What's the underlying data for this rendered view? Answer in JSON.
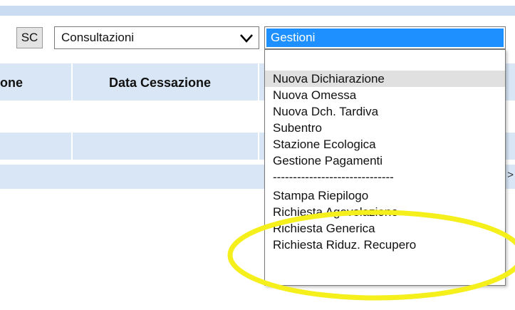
{
  "toolbar": {
    "sc_label": "SC",
    "consultazioni_value": "Consultazioni",
    "gestioni_value": "Gestioni"
  },
  "grid": {
    "columns": [
      "one",
      "Data Cessazione"
    ]
  },
  "gestioni_options": [
    "",
    "Nuova Dichiarazione",
    "Nuova Omessa",
    "Nuova Dch. Tardiva",
    "Subentro",
    "Stazione Ecologica",
    "Gestione Pagamenti",
    "------------------------------",
    "Stampa Riepilogo",
    "Richiesta Agevolazione",
    "Richiesta Generica",
    "Richiesta Riduz. Recupero"
  ],
  "pager": {
    "next_symbol": ">"
  },
  "colors": {
    "header_band": "#d8e6f6",
    "selected_option": "#1e90ff",
    "hover_option": "#e0e0e0",
    "annotation": "#f5ef1c"
  },
  "icons": {
    "select_arrow": "chevron-down-icon"
  }
}
